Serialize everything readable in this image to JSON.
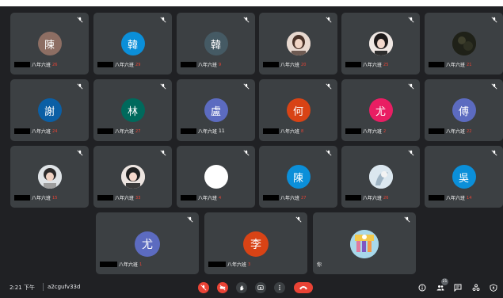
{
  "meeting": {
    "time": "2:21 下午",
    "code": "a2cgufv33d",
    "participant_count": "21"
  },
  "tiles": [
    {
      "id": "t1",
      "avatar": "陳",
      "avatar_color": "#8d6e63",
      "label": "八年六班",
      "mark": "26"
    },
    {
      "id": "t2",
      "avatar": "韓",
      "avatar_color": "#0b8fd9",
      "label": "八年六班",
      "mark": "29"
    },
    {
      "id": "t3",
      "avatar": "韓",
      "avatar_color": "#455a64",
      "label": "八年六班",
      "mark": "9"
    },
    {
      "id": "t4",
      "avatar": "",
      "avatar_color": "#d7c4bb",
      "label": "八年六班",
      "mark": "20"
    },
    {
      "id": "t5",
      "avatar": "",
      "avatar_color": "#e0d5d0",
      "label": "八年六班",
      "mark": "25"
    },
    {
      "id": "t6",
      "avatar": "",
      "avatar_color": "#2b2b1f",
      "label": "八年六班",
      "mark": "21"
    },
    {
      "id": "t7",
      "avatar": "謝",
      "avatar_color": "#0b5fa5",
      "label": "八年六班",
      "mark": "24"
    },
    {
      "id": "t8",
      "avatar": "林",
      "avatar_color": "#00695c",
      "label": "八年六班",
      "mark": "27"
    },
    {
      "id": "t9",
      "avatar": "盧",
      "avatar_color": "#5c6bc0",
      "label": "八年六班",
      "mark": "11"
    },
    {
      "id": "t10",
      "avatar": "何",
      "avatar_color": "#d84315",
      "label": "八年六班",
      "mark": "8"
    },
    {
      "id": "t11",
      "avatar": "尤",
      "avatar_color": "#e91e63",
      "label": "八年六班",
      "mark": "2"
    },
    {
      "id": "t12",
      "avatar": "傅",
      "avatar_color": "#5c6bc0",
      "label": "八年六班",
      "mark": "22"
    },
    {
      "id": "t13",
      "avatar": "",
      "avatar_color": "#cfd8dc",
      "label": "八年六班",
      "mark": "15"
    },
    {
      "id": "t14",
      "avatar": "",
      "avatar_color": "#d7ccc8",
      "label": "八年六班",
      "mark": "33"
    },
    {
      "id": "t15",
      "avatar": "",
      "avatar_color": "#ffffff",
      "label": "八年六班",
      "mark": "4"
    },
    {
      "id": "t16",
      "avatar": "陳",
      "avatar_color": "#0b8fd9",
      "label": "八年六班",
      "mark": "27"
    },
    {
      "id": "t17",
      "avatar": "",
      "avatar_color": "#e3eef5",
      "label": "八年六班",
      "mark": "26"
    },
    {
      "id": "t18",
      "avatar": "吳",
      "avatar_color": "#0b8fd9",
      "label": "八年六班",
      "mark": "14"
    },
    {
      "id": "t19",
      "avatar": "尤",
      "avatar_color": "#5c6bc0",
      "label": "八年六班",
      "mark": "1"
    },
    {
      "id": "t20",
      "avatar": "李",
      "avatar_color": "#d84315",
      "label": "八年六班",
      "mark": "3"
    },
    {
      "id": "t21",
      "avatar": "",
      "avatar_color": "#8ecae6",
      "label": "你",
      "mark": ""
    }
  ],
  "colors": {
    "background": "#202124",
    "tile": "#3c4043",
    "danger": "#ea4335"
  },
  "icons": [
    "mic-off-icon",
    "camera-off-icon",
    "raise-hand-icon",
    "present-icon",
    "more-icon",
    "end-call-icon",
    "info-icon",
    "people-icon",
    "chat-icon",
    "activities-icon",
    "host-controls-icon"
  ]
}
